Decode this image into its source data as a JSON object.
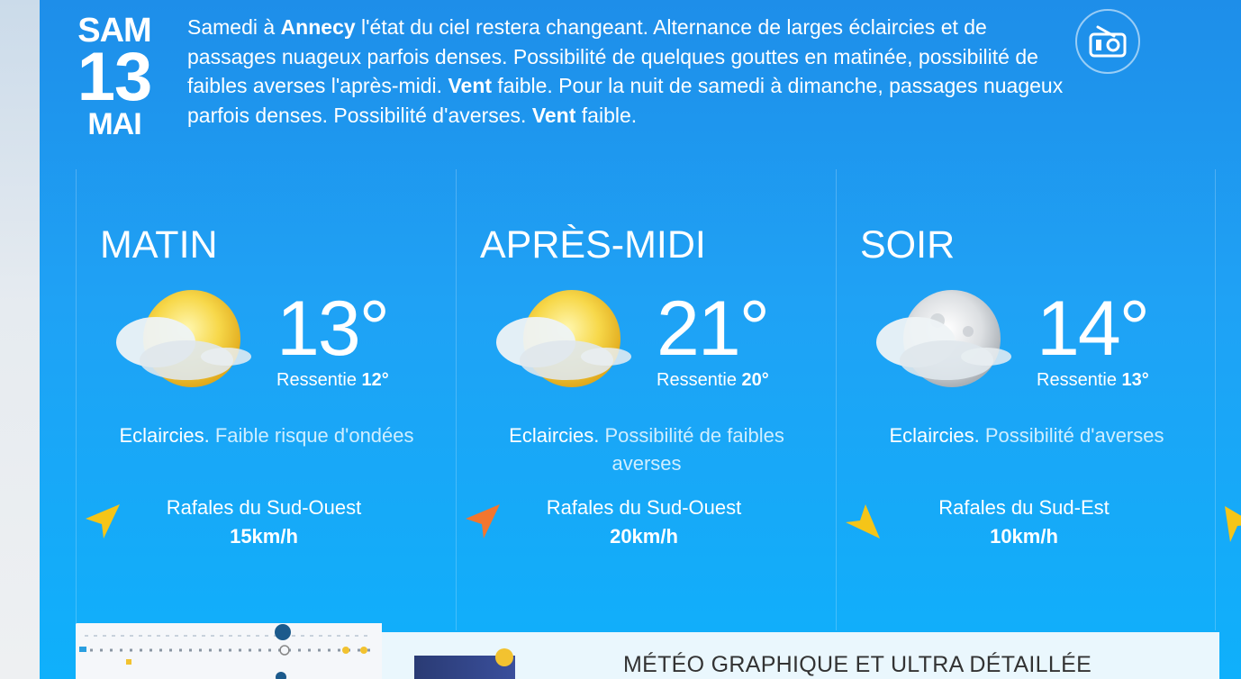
{
  "date": {
    "dow": "SAM",
    "day": "13",
    "month": "MAI"
  },
  "summary": {
    "p1": "Samedi à ",
    "city": "Annecy",
    "p2": " l'état du ciel restera changeant. Alternance de larges éclaircies et de passages nuageux parfois denses. Possibilité de quelques gouttes en matinée, possibilité de faibles averses l'après-midi. ",
    "wind1": "Vent",
    "p3": " faible. Pour la nuit de samedi à dimanche, passages nuageux parfois denses. Possibilité d'averses. ",
    "wind2": "Vent",
    "p4": " faible."
  },
  "periods": [
    {
      "name": "MATIN",
      "temp": "13°",
      "feel_label": "Ressentie ",
      "feel_value": "12°",
      "condition": "Eclaircies.",
      "detail": " Faible risque d'ondées",
      "wind_label": "Rafales du Sud-Ouest",
      "wind_speed": "15km/h",
      "arrow_color": "#f5c518",
      "icon": "sun-cloud-icon"
    },
    {
      "name": "APRÈS-MIDI",
      "temp": "21°",
      "feel_label": "Ressentie ",
      "feel_value": "20°",
      "condition": "Eclaircies.",
      "detail": " Possibilité de faibles averses",
      "wind_label": "Rafales du Sud-Ouest",
      "wind_speed": "20km/h",
      "arrow_color": "#f2762e",
      "icon": "sun-cloud-icon"
    },
    {
      "name": "SOIR",
      "temp": "14°",
      "feel_label": "Ressentie ",
      "feel_value": "13°",
      "condition": "Eclaircies.",
      "detail": " Possibilité d'averses",
      "wind_label": "Rafales du Sud-Est",
      "wind_speed": "10km/h",
      "arrow_color": "#f5c518",
      "icon": "moon-cloud-icon"
    }
  ],
  "promo": {
    "title": "MÉTÉO GRAPHIQUE ET ULTRA DÉTAILLÉE"
  },
  "colors": {
    "panel_top": "#1e8ee9",
    "panel_bottom": "#0fb0fb",
    "arrow_yellow": "#f5c518",
    "arrow_orange": "#f2762e"
  }
}
